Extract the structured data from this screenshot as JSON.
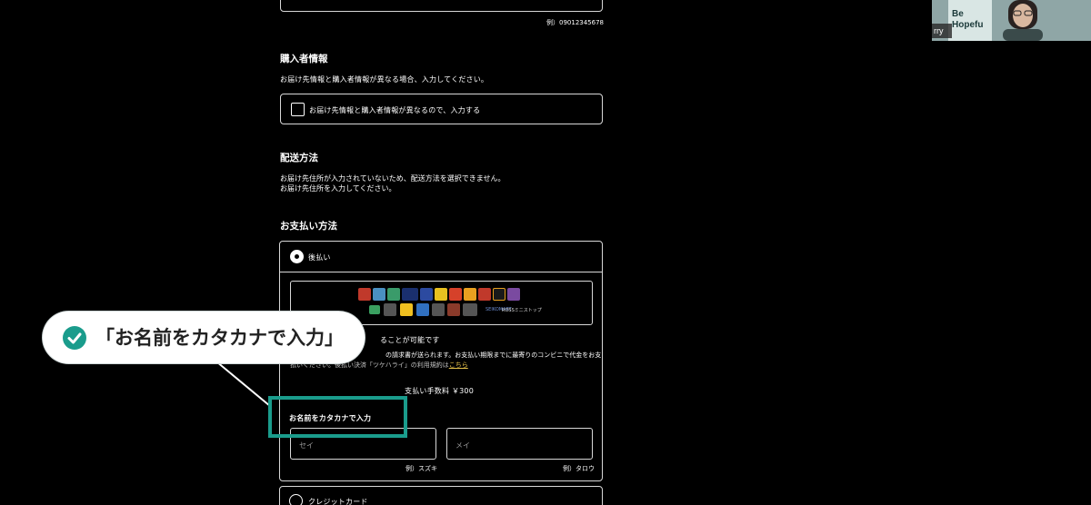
{
  "phone": {
    "example": "例）09012345678"
  },
  "buyer_info": {
    "title": "購入者情報",
    "description": "お届け先情報と購入者情報が異なる場合、入力してください。",
    "checkbox_label": "お届け先情報と購入者情報が異なるので、入力する"
  },
  "shipping": {
    "title": "配送方法",
    "line1": "お届け先住所が入力されていないため、配送方法を選択できません。",
    "line2": "お届け先住所を入力してください。"
  },
  "payment": {
    "title": "お支払い方法",
    "deferred_label": "後払い",
    "logos_note": "ROSSミニストップ",
    "desc_line1_visible": "ることが可能です",
    "desc_line2_visible": "の請求書が送られます。お支払い期限までに最寄りのコンビニで代金をお支",
    "desc_line3_visible": "払いください。後払い決済「ツケハライ」の利用規約は",
    "terms_link": "こちら",
    "fee": "支払い手数料 ￥300",
    "kana_label": "お名前をカタカナで入力",
    "sei_placeholder": "セイ",
    "mei_placeholder": "メイ",
    "sei_example": "例）スズキ",
    "mei_example": "例）タロウ",
    "credit_label": "クレジットカード"
  },
  "callout": {
    "text": "「お名前をカタカナで入力」"
  },
  "webcam": {
    "sign_line1": "Be",
    "sign_line2": "Hopefu",
    "name_fragment": "rry"
  },
  "colors": {
    "accent": "#1a9c8c",
    "link": "#e6c24a"
  }
}
